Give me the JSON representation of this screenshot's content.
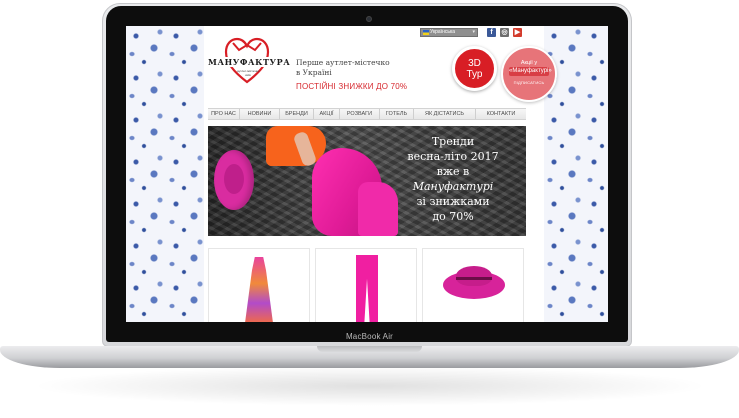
{
  "device": {
    "label": "MacBook Air"
  },
  "site": {
    "logo": {
      "name": "МАНУФАКТУРА",
      "subtitle": "аутлет-містечко київ"
    },
    "tagline_line1": "Перше аутлет-містечко",
    "tagline_line2": "в Україні",
    "promo": "ПОСТІЙНІ ЗНИЖКИ ДО 70%",
    "language": {
      "selected": "Українська"
    },
    "social": [
      {
        "name": "facebook",
        "glyph": "f"
      },
      {
        "name": "instagram",
        "glyph": "◎"
      },
      {
        "name": "youtube",
        "glyph": "▶"
      }
    ],
    "tour_button": {
      "line1": "3D",
      "line2": "Тур"
    },
    "actions_badge": {
      "line1": "Акції у",
      "line2": "«Мануфактурі»",
      "sub": "ПІДПИСАТИСЬ"
    },
    "nav": [
      "ПРО НАС",
      "НОВИНИ",
      "БРЕНДИ",
      "АКЦІЇ",
      "РОЗВАГИ",
      "ГОТЕЛЬ",
      "ЯК ДІСТАТИСЬ",
      "КОНТАКТИ"
    ],
    "hero": {
      "line1": "Тренди",
      "line2": "весна-літо 2017",
      "line3": "вже в",
      "line4": "Мануфактурі",
      "line5": "зі знижками",
      "line6": "до 70%"
    },
    "products": [
      "dress",
      "trousers",
      "hat"
    ]
  },
  "colors": {
    "brand_red": "#d81e25",
    "accent_pink": "#e77479",
    "nav_text": "#4a4a4a"
  }
}
